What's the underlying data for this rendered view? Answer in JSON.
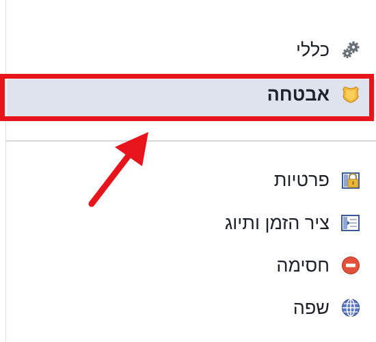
{
  "sidebar": {
    "items": [
      {
        "label": "כללי",
        "icon": "gears-icon"
      },
      {
        "label": "אבטחה",
        "icon": "shield-badge-icon",
        "selected": true
      },
      {
        "label": "פרטיות",
        "icon": "lock-icon"
      },
      {
        "label": "ציר הזמן ותיוג",
        "icon": "timeline-icon"
      },
      {
        "label": "חסימה",
        "icon": "block-icon"
      },
      {
        "label": "שפה",
        "icon": "globe-icon"
      }
    ]
  },
  "colors": {
    "annotation_red": "#e8141b",
    "selected_background": "#dfe3ee",
    "text": "#1d2129"
  }
}
